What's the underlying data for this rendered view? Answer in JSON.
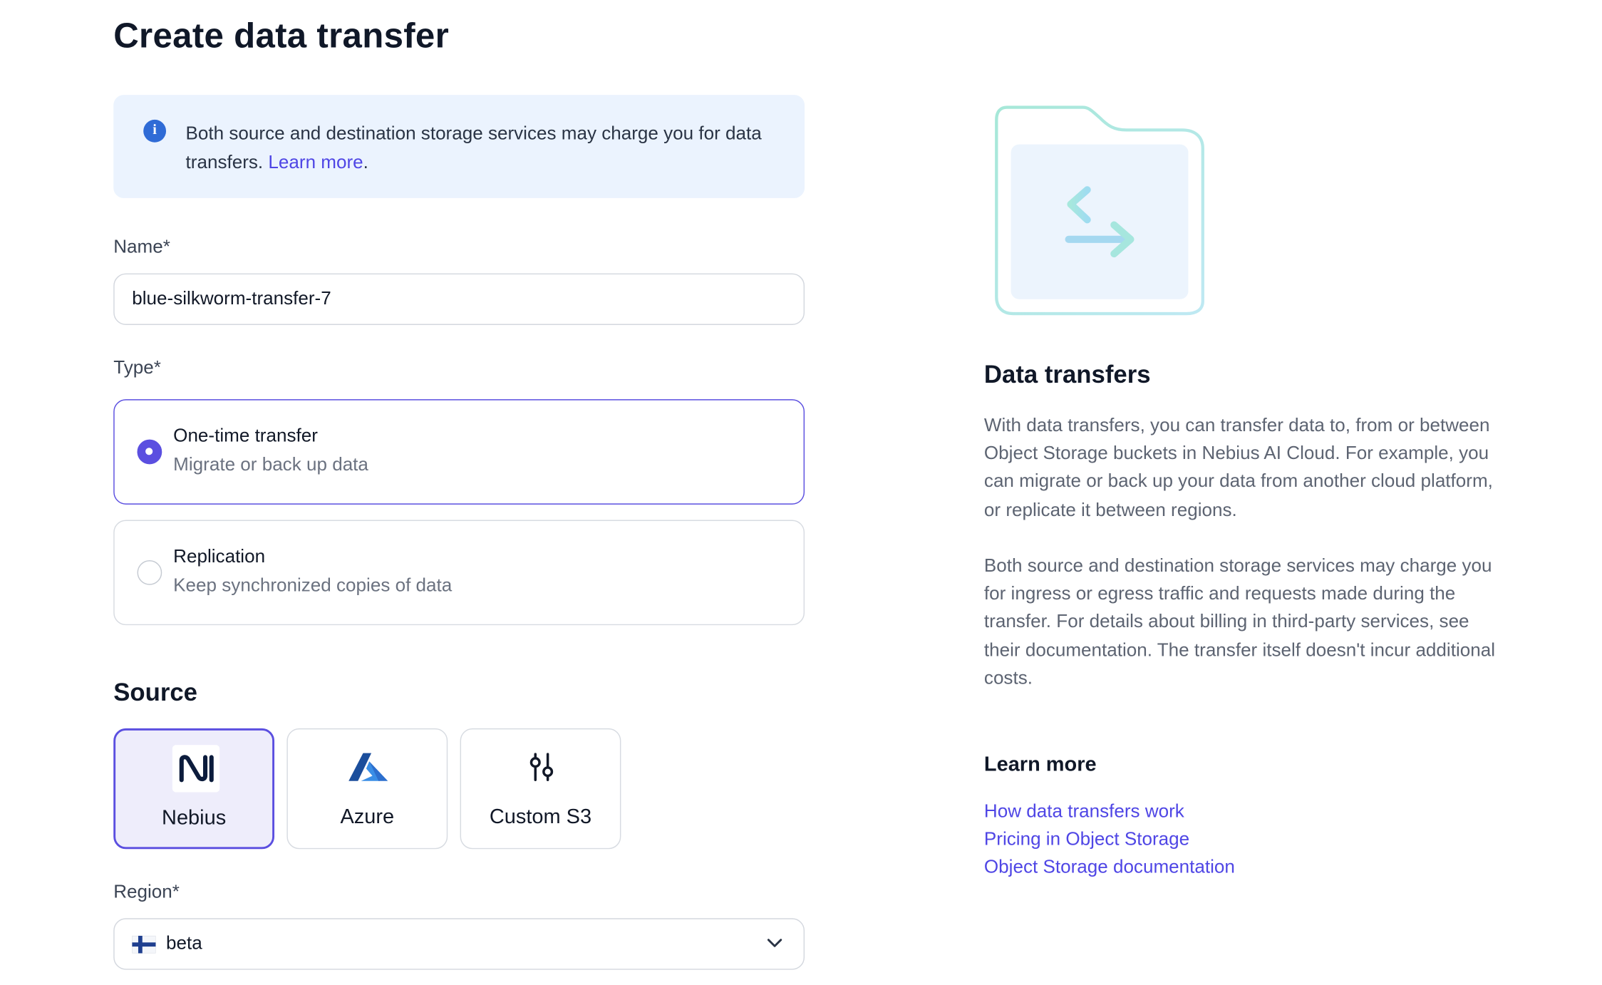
{
  "page": {
    "title": "Create data transfer"
  },
  "banner": {
    "text": "Both source and destination storage services may charge you for data transfers.",
    "link": "Learn more",
    "suffix": ".",
    "icon": "info-icon"
  },
  "name_field": {
    "label": "Name*",
    "value": "blue-silkworm-transfer-7"
  },
  "type_field": {
    "label": "Type*",
    "options": [
      {
        "title": "One-time transfer",
        "subtitle": "Migrate or back up data",
        "selected": true
      },
      {
        "title": "Replication",
        "subtitle": "Keep synchronized copies of data",
        "selected": false
      }
    ]
  },
  "source": {
    "heading": "Source",
    "options": [
      {
        "label": "Nebius",
        "icon": "nebius-logo-icon",
        "selected": true
      },
      {
        "label": "Azure",
        "icon": "azure-logo-icon",
        "selected": false
      },
      {
        "label": "Custom S3",
        "icon": "sliders-icon",
        "selected": false
      }
    ]
  },
  "region_field": {
    "label": "Region*",
    "value": "beta",
    "icon": "finland-flag-icon"
  },
  "side": {
    "heading": "Data transfers",
    "paragraph1": "With data transfers, you can transfer data to, from or between Object Storage buckets in Nebius AI Cloud. For example, you can migrate or back up your data from another cloud platform, or replicate it between regions.",
    "paragraph2": "Both source and destination storage services may charge you for ingress or egress traffic and requests made during the transfer. For details about billing in third-party services, see their documentation. The transfer itself doesn't incur additional costs.",
    "learn_more_heading": "Learn more",
    "links": [
      "How data transfers work",
      "Pricing in Object Storage",
      "Object Storage documentation"
    ]
  },
  "colors": {
    "accent": "#5b4fe0",
    "link": "#4f46e5",
    "banner_bg": "#ebf3fe",
    "info_icon": "#2f6bd6"
  }
}
